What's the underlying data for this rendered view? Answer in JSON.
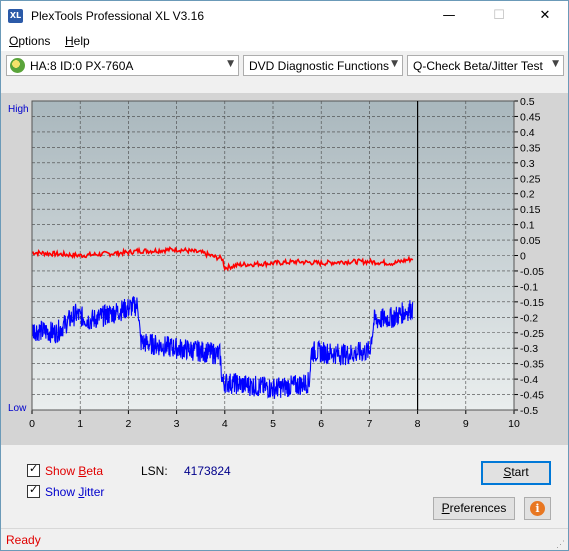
{
  "window": {
    "title": "PlexTools Professional XL V3.16",
    "icon_text": "XL",
    "minimize_glyph": "—",
    "maximize_glyph": "☐",
    "close_glyph": "✕"
  },
  "menu": {
    "items": [
      {
        "label": "Options",
        "accel": "O",
        "rest": "ptions"
      },
      {
        "label": "Help",
        "accel": "H",
        "rest": "elp"
      }
    ]
  },
  "toolbar": {
    "drive": "HA:8 ID:0  PX-760A",
    "function": "DVD Diagnostic Functions",
    "test": "Q-Check Beta/Jitter Test",
    "arrow": "▼"
  },
  "chart_data": {
    "type": "line",
    "x_ticks": [
      "0",
      "1",
      "2",
      "3",
      "4",
      "5",
      "6",
      "7",
      "8",
      "9",
      "10"
    ],
    "xlim": [
      0,
      10
    ],
    "y_left_labels": {
      "top": "High",
      "bottom": "Low"
    },
    "y_right_ticks": [
      "0.5",
      "0.45",
      "0.4",
      "0.35",
      "0.3",
      "0.25",
      "0.2",
      "0.15",
      "0.1",
      "0.05",
      "0",
      "-0.05",
      "-0.1",
      "-0.15",
      "-0.2",
      "-0.25",
      "-0.3",
      "-0.35",
      "-0.4",
      "-0.45",
      "-0.5"
    ],
    "ylim": [
      -0.5,
      0.5
    ],
    "grid": true,
    "cursor_x": 8,
    "series": [
      {
        "color": "#ff0000",
        "x": [
          0,
          0.5,
          1,
          1.5,
          2,
          2.2,
          2.5,
          3,
          3.5,
          3.6,
          3.8,
          3.95,
          4.0,
          4.3,
          5,
          5.5,
          6,
          6.5,
          7,
          7.5,
          7.9
        ],
        "values": [
          0.01,
          0.005,
          0.0,
          0.005,
          0.01,
          0.015,
          0.015,
          0.02,
          0.01,
          0.005,
          -0.005,
          -0.01,
          -0.04,
          -0.03,
          -0.025,
          -0.02,
          -0.025,
          -0.02,
          -0.02,
          -0.025,
          -0.01
        ]
      },
      {
        "color": "#0000ff",
        "x": [
          0,
          0.5,
          0.9,
          1.2,
          1.6,
          2.0,
          2.2,
          2.25,
          2.6,
          3.0,
          3.5,
          3.9,
          3.95,
          4.5,
          5.0,
          5.5,
          5.75,
          5.8,
          6.5,
          7.0,
          7.1,
          7.5,
          7.9
        ],
        "values": [
          -0.24,
          -0.25,
          -0.19,
          -0.21,
          -0.19,
          -0.17,
          -0.16,
          -0.28,
          -0.29,
          -0.3,
          -0.31,
          -0.32,
          -0.41,
          -0.42,
          -0.43,
          -0.42,
          -0.41,
          -0.31,
          -0.32,
          -0.31,
          -0.21,
          -0.2,
          -0.17
        ]
      }
    ]
  },
  "options": {
    "show_beta": {
      "label": "Show Beta",
      "accel": "B",
      "pre": "Show ",
      "rest": "eta",
      "checked": true,
      "color": "#e00000"
    },
    "show_jitter": {
      "label": "Show Jitter",
      "accel": "J",
      "pre": "Show ",
      "rest": "itter",
      "checked": true,
      "color": "#0000cc"
    },
    "check_glyph": "✓"
  },
  "lsn": {
    "label": "LSN:",
    "value": "4173824"
  },
  "buttons": {
    "start": "Start",
    "start_accel": "S",
    "start_rest": "tart",
    "preferences": "Preferences",
    "pref_accel": "P",
    "pref_rest": "references",
    "info_glyph": "i"
  },
  "status": {
    "text": "Ready"
  }
}
